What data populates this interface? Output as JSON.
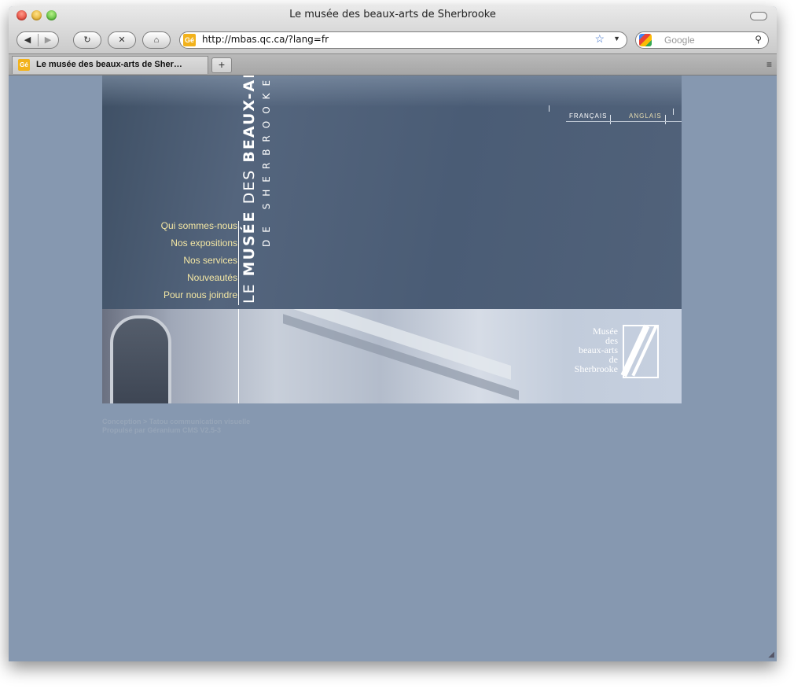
{
  "window": {
    "title": "Le musée des beaux-arts de Sherbrooke"
  },
  "toolbar": {
    "back_icon": "◀",
    "forward_icon": "▶",
    "reload_icon": "↻",
    "stop_icon": "✕",
    "home_icon": "⌂",
    "url": "http://mbas.qc.ca/?lang=fr",
    "site_icon_text": "Gé",
    "search_placeholder": "Google"
  },
  "tabs": [
    {
      "label": "Le musée des beaux-arts de Sher…",
      "icon_text": "Gé"
    }
  ],
  "site": {
    "logo_line1_a": "LE ",
    "logo_line1_b": "MUSÉE",
    "logo_line1_c": " DES ",
    "logo_line1_d": "BEAUX-ARTS",
    "logo_line2": "DE SHERBROOKE",
    "nav": [
      "Qui sommes-nous",
      "Nos expositions",
      "Nos services",
      "Nouveautés",
      "Pour nous joindre"
    ],
    "lang_fr": "FRANÇAIS",
    "lang_en": "ANGLAIS",
    "brand_lines": [
      "Musée",
      "des",
      "beaux-arts",
      "de",
      "Sherbrooke"
    ],
    "footer_line1": "Conception > Tatou communication visuelle",
    "footer_line2": "Propulsé par Géranium CMS V2.5-3"
  },
  "colors": {
    "page_bg": "#8698b0",
    "banner": "#4a5c75",
    "nav_text": "#f4e7a4"
  }
}
